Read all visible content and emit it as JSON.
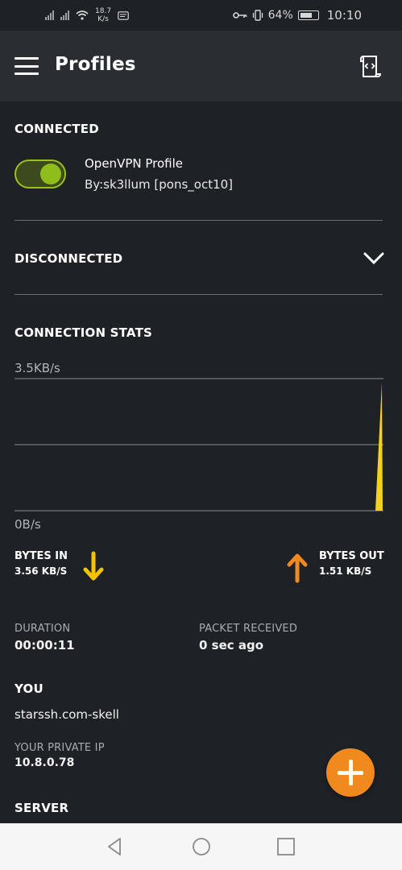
{
  "status_bar": {
    "speed_value": "18.7",
    "speed_unit": "K/s",
    "battery_percent": "64%",
    "time": "10:10",
    "icons": [
      "signal-icon",
      "signal-icon",
      "wifi-icon",
      "message-icon",
      "vpn-key-icon",
      "vibrate-icon",
      "battery-icon"
    ]
  },
  "app_bar": {
    "title": "Profiles",
    "menu_icon": "hamburger-menu-icon",
    "action_icon": "import-profile-icon"
  },
  "connected": {
    "heading": "CONNECTED",
    "toggle_on": true,
    "profile_name": "OpenVPN Profile",
    "profile_by": "By:sk3llum [pons_oct10]"
  },
  "disconnected": {
    "heading": "DISCONNECTED",
    "expand_icon": "chevron-down-icon"
  },
  "stats": {
    "heading": "CONNECTION STATS",
    "max_label": "3.5KB/s",
    "min_label": "0B/s",
    "bytes_in_label": "BYTES IN",
    "bytes_in_value": "3.56 KB/S",
    "bytes_out_label": "BYTES OUT",
    "bytes_out_value": "1.51 KB/S",
    "duration_label": "DURATION",
    "duration_value": "00:00:11",
    "packet_label": "PACKET RECEIVED",
    "packet_value": "0 sec ago"
  },
  "chart_data": {
    "type": "area",
    "y_tick_labels": [
      "3.5KB/s",
      "0B/s"
    ],
    "ylim": [
      0,
      3.5
    ],
    "series": [
      {
        "color": "#f2d21b",
        "values": [
          0,
          0,
          0,
          0,
          0,
          0,
          0,
          0,
          0,
          0,
          3.4
        ]
      }
    ],
    "grid": true
  },
  "you": {
    "heading": "YOU",
    "name": "starssh.com-skell",
    "private_ip_label": "YOUR PRIVATE IP",
    "private_ip_value": "10.8.0.78"
  },
  "server": {
    "heading": "SERVER"
  },
  "colors": {
    "accent_green": "#8fbe1c",
    "bytes_in_yellow": "#f5c400",
    "bytes_out_orange": "#f08a1e",
    "fab_orange": "#f08a1e"
  },
  "nav_bar": {
    "icons": [
      "back-icon",
      "home-icon",
      "recents-icon"
    ]
  }
}
